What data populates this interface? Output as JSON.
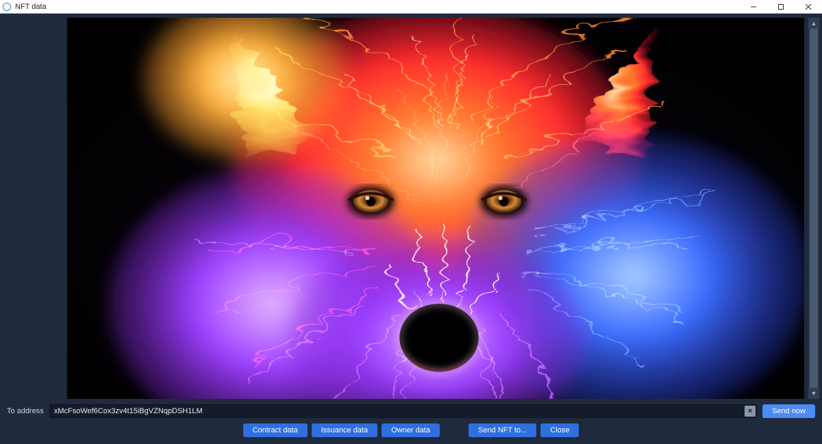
{
  "window": {
    "title": "NFT data"
  },
  "address": {
    "label": "To address",
    "value": "xMcFsoWef6Cox3zv4t15iBgVZNqpDSH1LM",
    "clear_glyph": "×"
  },
  "buttons": {
    "send_now": "Send now",
    "contract_data": "Contract data",
    "issuance_data": "Issuance data",
    "owner_data": "Owner data",
    "send_nft_to": "Send NFT to...",
    "close": "Close"
  },
  "scroll": {
    "up_glyph": "▲",
    "down_glyph": "▼"
  },
  "image": {
    "alt": "neon-wolf-art"
  }
}
